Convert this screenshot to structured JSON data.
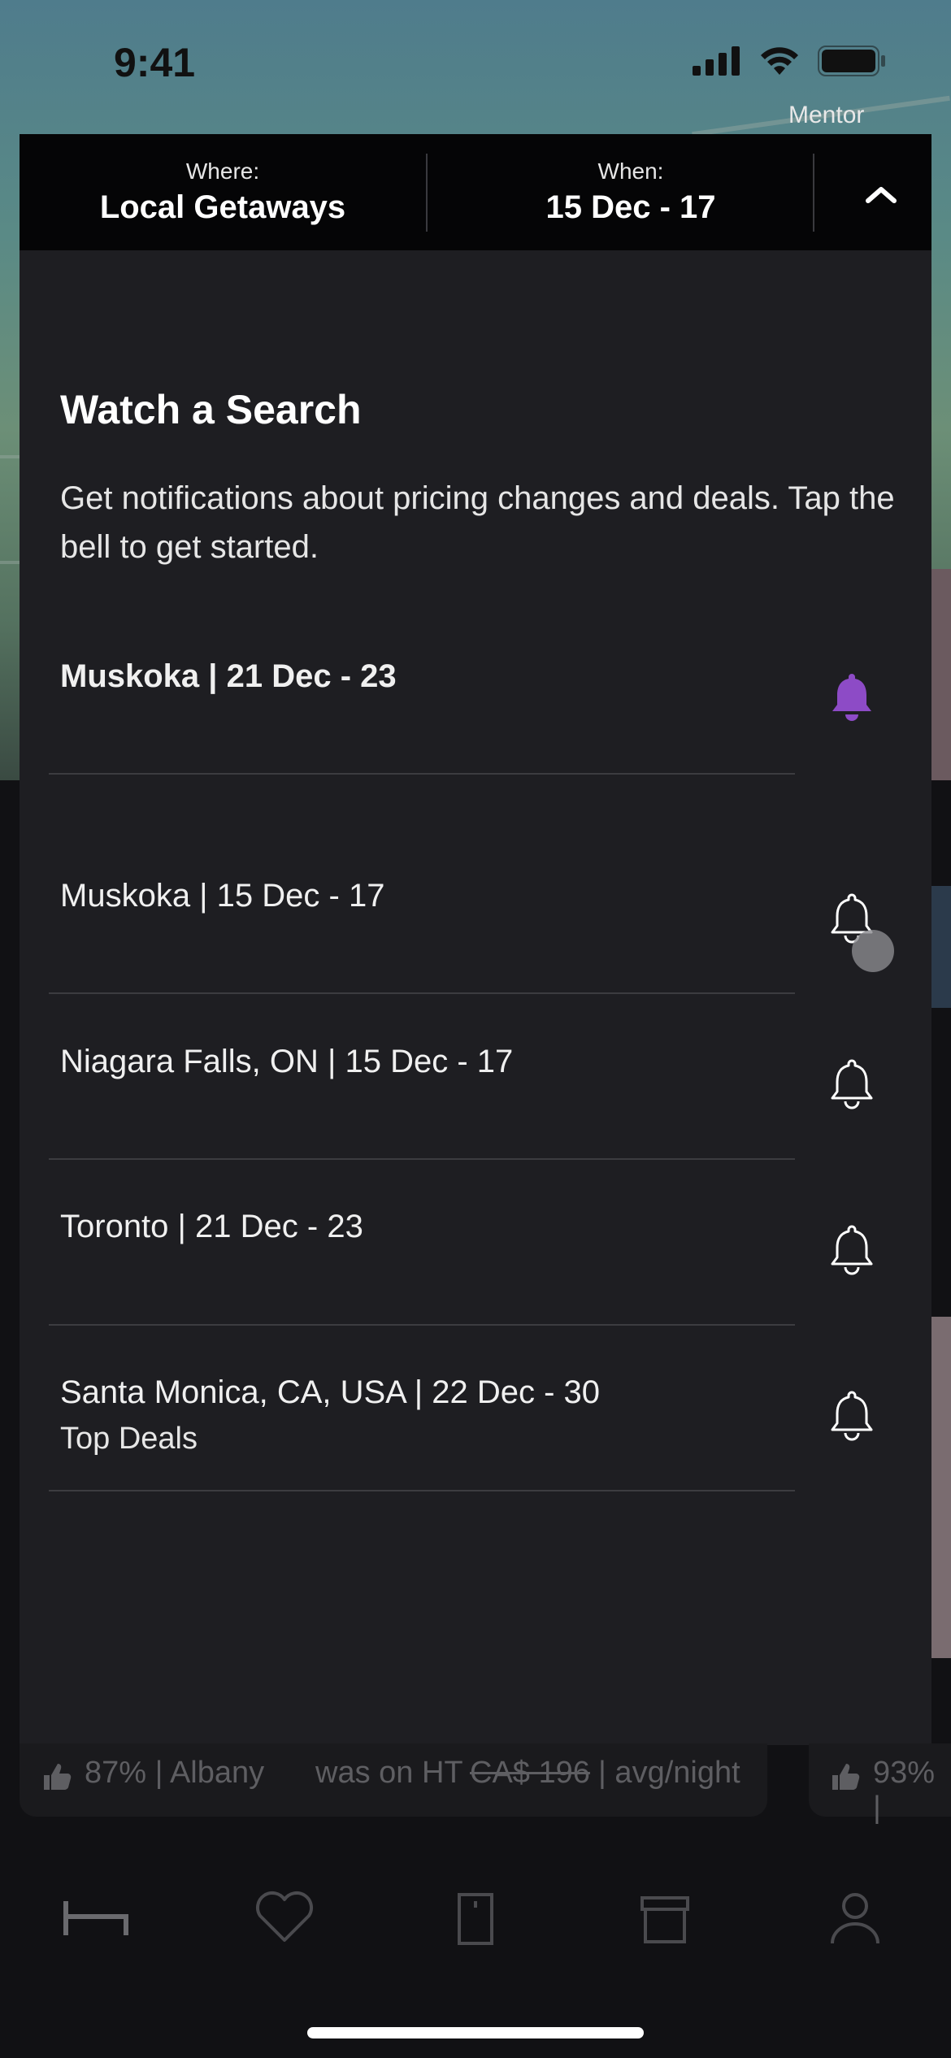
{
  "status": {
    "time": "9:41"
  },
  "map": {
    "label": "Mentor"
  },
  "search_header": {
    "where_label": "Where:",
    "where_value": "Local Getaways",
    "when_label": "When:",
    "when_value": "15 Dec - 17",
    "collapse_icon": "chevron-up-icon"
  },
  "watch": {
    "title": "Watch a Search",
    "description": "Get notifications about pricing changes and deals. Tap the bell to get started.",
    "items": [
      {
        "label": "Muskoka | 21 Dec - 23",
        "subtitle": "",
        "watched": true
      },
      {
        "label": "Muskoka | 15 Dec - 17",
        "subtitle": "",
        "watched": false
      },
      {
        "label": "Niagara Falls, ON | 15 Dec - 17",
        "subtitle": "",
        "watched": false
      },
      {
        "label": "Toronto | 21 Dec - 23",
        "subtitle": "",
        "watched": false
      },
      {
        "label": "Santa Monica, CA, USA | 22 Dec - 30",
        "subtitle": "Top Deals",
        "watched": false
      }
    ]
  },
  "background_card": {
    "rating": "87% | Albany",
    "was_on": "was on HT",
    "old_price": "CA$ 196",
    "per_night": "| avg/night",
    "rating2": "93% |"
  },
  "tab_bar": {
    "items": [
      {
        "icon": "bed-icon",
        "active": true
      },
      {
        "icon": "heart-icon",
        "active": false
      },
      {
        "icon": "door-icon",
        "active": false
      },
      {
        "icon": "gift-icon",
        "active": false
      },
      {
        "icon": "user-icon",
        "active": false
      }
    ]
  },
  "colors": {
    "accent": "#8d4bc6",
    "panel": "#1e1e22",
    "header": "#050506"
  }
}
